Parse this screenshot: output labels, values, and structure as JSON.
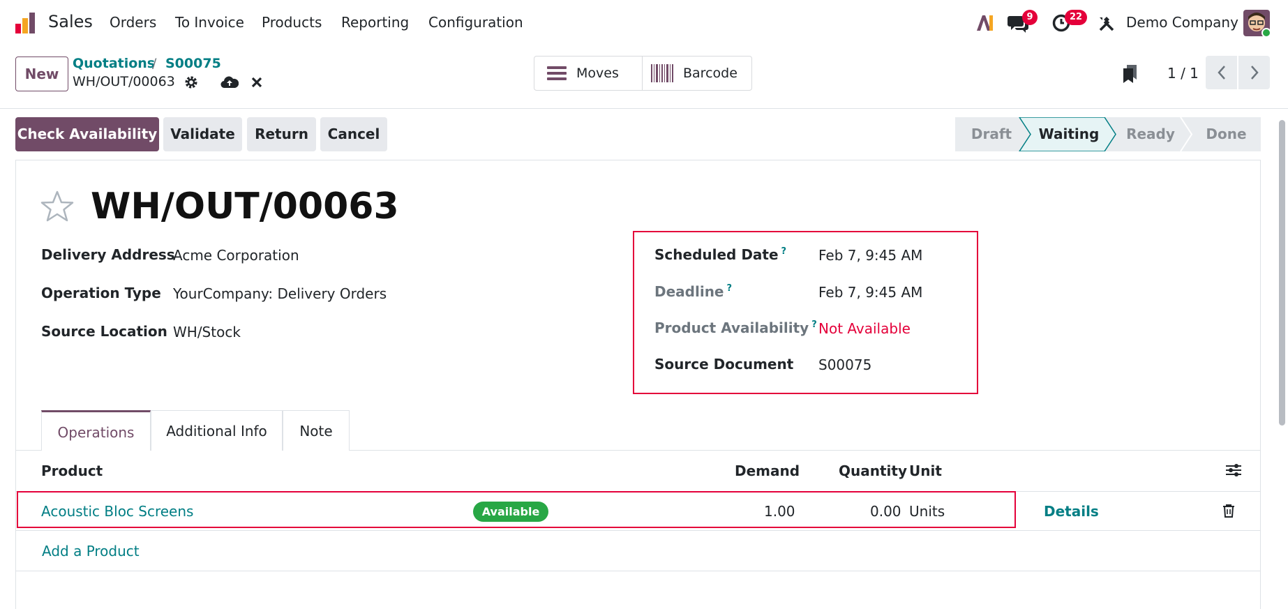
{
  "navbar": {
    "app_name": "Sales",
    "menu": [
      "Orders",
      "To Invoice",
      "Products",
      "Reporting",
      "Configuration"
    ],
    "messages_count": "9",
    "activities_count": "22",
    "company": "Demo Company"
  },
  "control_panel": {
    "new_label": "New",
    "breadcrumb": [
      "Quotations",
      "S00075"
    ],
    "record_name": "WH/OUT/00063",
    "smart_buttons": {
      "moves": "Moves",
      "barcode": "Barcode"
    },
    "pager": "1 / 1"
  },
  "actions": {
    "check_availability": "Check Availability",
    "validate": "Validate",
    "return": "Return",
    "cancel": "Cancel"
  },
  "statusbar": {
    "stages": [
      "Draft",
      "Waiting",
      "Ready",
      "Done"
    ],
    "current": "Waiting"
  },
  "form": {
    "title": "WH/OUT/00063",
    "left_fields": [
      {
        "label": "Delivery Address",
        "value": "Acme Corporation"
      },
      {
        "label": "Operation Type",
        "value": "YourCompany: Delivery Orders"
      },
      {
        "label": "Source Location",
        "value": "WH/Stock"
      }
    ],
    "right_fields": [
      {
        "label": "Scheduled Date",
        "help": "?",
        "value": "Feb 7, 9:45 AM"
      },
      {
        "label": "Deadline",
        "help": "?",
        "value": "Feb 7, 9:45 AM"
      },
      {
        "label": "Product Availability",
        "help": "?",
        "value": "Not Available"
      },
      {
        "label": "Source Document",
        "value": "S00075"
      }
    ]
  },
  "tabs": [
    "Operations",
    "Additional Info",
    "Note"
  ],
  "table": {
    "columns": {
      "product": "Product",
      "demand": "Demand",
      "quantity": "Quantity",
      "unit": "Unit"
    },
    "rows": [
      {
        "product": "Acoustic Bloc Screens",
        "badge": "Available",
        "demand": "1.00",
        "quantity": "0.00",
        "unit": "Units",
        "details": "Details"
      }
    ],
    "add_line": "Add a Product"
  },
  "colors": {
    "primary": "#714b67",
    "link": "#017e84",
    "danger": "#e4003a",
    "success": "#28a745"
  }
}
